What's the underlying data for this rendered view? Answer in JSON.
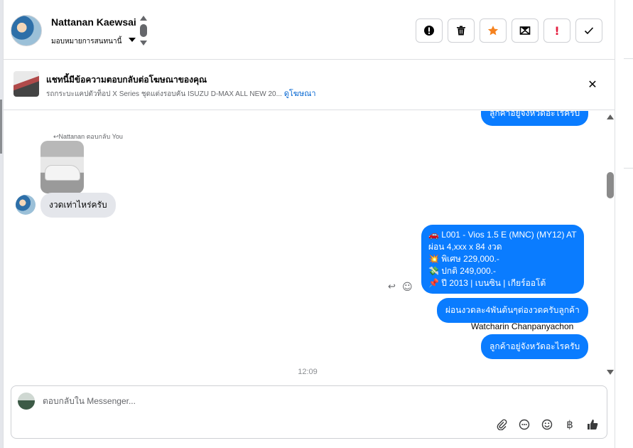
{
  "header": {
    "contact_name": "Nattanan Kaewsai",
    "assign_label": "มอบหมายการสนทนานี้"
  },
  "actions": {
    "spam_label": "!",
    "delete_label": "🗑",
    "star_label": "★",
    "mark_unread_label": "✉",
    "follow_up_label": "!",
    "done_label": "✓"
  },
  "ad_banner": {
    "title": "แชทนี้มีข้อความตอบกลับต่อโฆษณาของคุณ",
    "subtitle": "รถกระบะแคปตัวท็อป X Series ชุดแต่งรอบคัน ISUZU D-MAX ALL NEW 20...",
    "link": "ดูโฆษณา",
    "close": "✕"
  },
  "chat": {
    "cut_off_message": "ลูกค้าอยู่จังหวัดอะไรครับ",
    "reply_note": "↩Nattanan ตอบกลับ You",
    "incoming_message": "งวดเท่าไหร่ครับ",
    "offer_message": {
      "line1": "🚗 L001 - Vios 1.5 E (MNC) (MY12) AT",
      "line2": "ผ่อน 4,xxx x 84 งวด",
      "line3": "💥 พิเศษ 229,000.-",
      "line4": "💸 ปกติ 249,000.-",
      "line5": "📌 ปี 2013 | เบนซิน | เกียร์ออโต้"
    },
    "installment_message": "ผ่อนงวดละ4พันต้นๆต่องวดครับลูกค้า",
    "sender_name": "Watcharin Chanpanyachon",
    "province_message": "ลูกค้าอยู่จังหวัดอะไรครับ",
    "timestamp": "12:09"
  },
  "composer": {
    "placeholder": "ตอบกลับใน Messenger..."
  },
  "colors": {
    "accent": "#0a7cff",
    "incoming_bubble": "#e4e6eb",
    "star": "#f5821f",
    "follow_up": "#e41e3f"
  }
}
